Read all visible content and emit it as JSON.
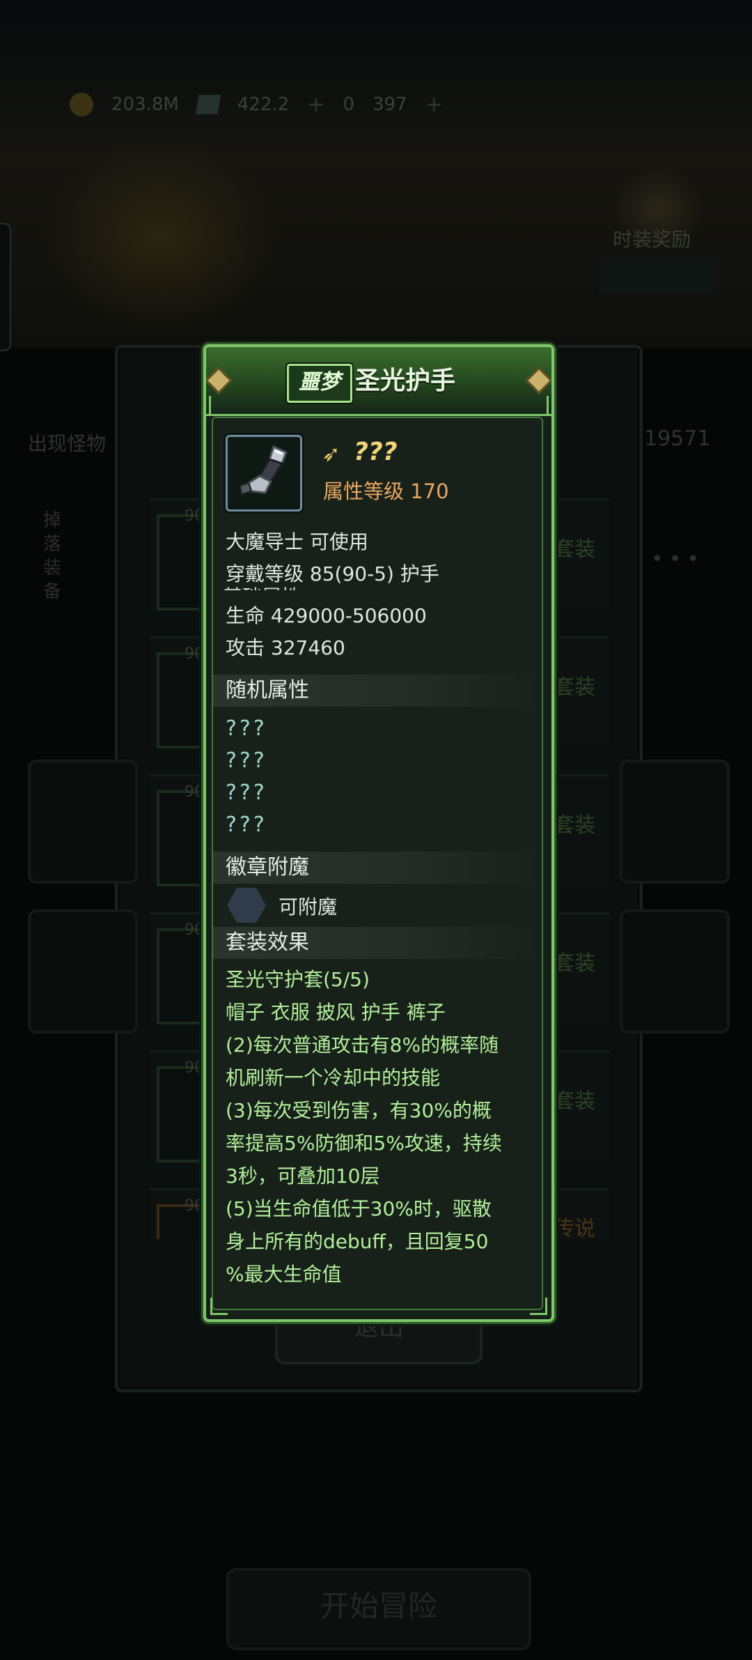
{
  "background": {
    "resources": [
      "203.8M",
      "422.2",
      "0",
      "397"
    ],
    "monster_label": "出现怪物",
    "right_number": "19571",
    "badge_label": "时装奖励",
    "row_levels": [
      "90",
      "90",
      "90",
      "90",
      "90",
      "90"
    ],
    "row_tags": [
      "套装",
      "套装",
      "套装",
      "套装",
      "套装",
      "传说"
    ],
    "exit_label": "退出",
    "start_label": "开始冒险"
  },
  "card": {
    "rarity": "噩梦",
    "name": "圣光护手",
    "unknown_name": "???",
    "attr_level": "属性等级 170",
    "usable_by": "大魔导士 可使用",
    "wear_level": "穿戴等级 85(90-5) 护手",
    "base_section_hidden": "基础属性",
    "hp": "生命  429000-506000",
    "attack": "攻击  327460",
    "random_section": "随机属性",
    "random_attrs": [
      "???",
      "???",
      "???",
      "???"
    ],
    "enchant_section": "徽章附魔",
    "enchant_label": "可附魔",
    "set_section": "套装效果",
    "set_lines": [
      "圣光守护套(5/5)",
      "帽子 衣服 披风 护手 裤子",
      "(2)每次普通攻击有8%的概率随",
      "机刷新一个冷却中的技能",
      "(3)每次受到伤害，有30%的概",
      "率提高5%防御和5%攻速，持续",
      "3秒，可叠加10层",
      "(5)当生命值低于30%时，驱散",
      "身上所有的debuff，且回复50",
      "%最大生命值"
    ],
    "colors": {
      "border": "#7fc86a",
      "set_text": "#b3ef9b",
      "attr_level": "#e9a762",
      "question": "#9fd8d0"
    }
  }
}
